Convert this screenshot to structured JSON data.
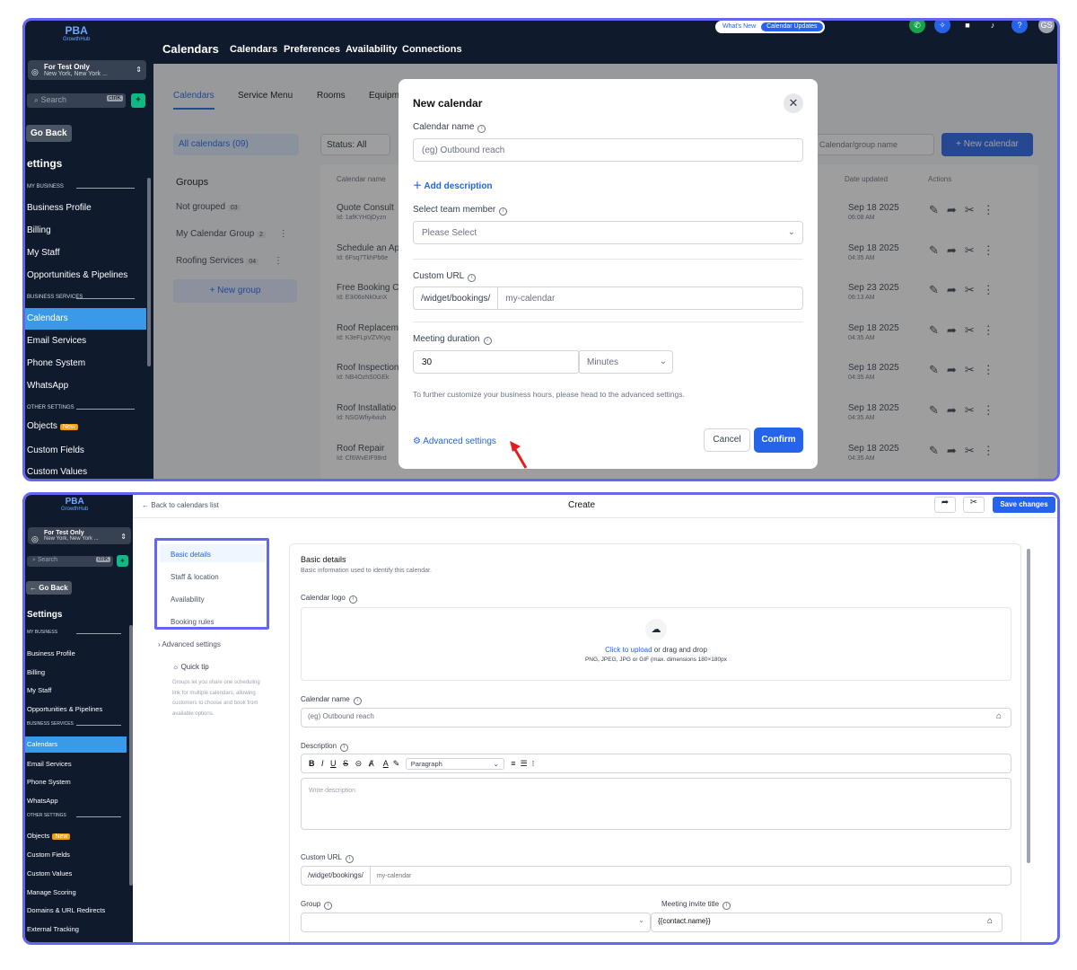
{
  "brand": {
    "name": "PBA",
    "sub": "GrowthHub"
  },
  "account": {
    "name": "For Test Only",
    "location": "New York, New York ..."
  },
  "search": {
    "placeholder": "Search",
    "shortcut": "ctrlK"
  },
  "sidebar": {
    "go_back": "Go Back",
    "go_back_bottom": "← Go Back",
    "title": "ettings",
    "title_bottom": "Settings",
    "sec_my_business": "MY BUSINESS",
    "sec_business_services": "BUSINESS SERVICES",
    "sec_other_settings": "OTHER SETTINGS",
    "new_badge": "New",
    "top_items": [
      "Business Profile",
      "Billing",
      "My Staff",
      "Opportunities & Pipelines",
      "Calendars",
      "Email Services",
      "Phone System",
      "WhatsApp",
      "Objects",
      "Custom Fields",
      "Custom Values"
    ],
    "bottom_items": [
      "Business Profile",
      "Billing",
      "My Staff",
      "Opportunities & Pipelines",
      "Calendars",
      "Email Services",
      "Phone System",
      "WhatsApp",
      "Objects",
      "Custom Fields",
      "Custom Values",
      "Manage Scoring",
      "Domains & URL Redirects",
      "External Tracking"
    ]
  },
  "header": {
    "title": "Calendars",
    "tabs": [
      "Calendars",
      "Preferences",
      "Availability",
      "Connections"
    ],
    "whats_new": "What's New",
    "calendar_updates": "Calendar Updates",
    "avatar": "GS"
  },
  "subtabs": [
    "Calendars",
    "Service Menu",
    "Rooms",
    "Equipm"
  ],
  "filters": {
    "all": "All calendars (09)",
    "status": "Status: All",
    "search_placeholder": "Calendar/group name",
    "new_calendar": "+ New calendar"
  },
  "groups": {
    "title": "Groups",
    "items": [
      {
        "name": "Not grouped",
        "count": "03"
      },
      {
        "name": "My Calendar Group",
        "count": "2"
      },
      {
        "name": "Roofing Services",
        "count": "04"
      }
    ],
    "new_group": "+ New group"
  },
  "table": {
    "col_name": "Calendar name",
    "col_date": "Date updated",
    "col_actions": "Actions",
    "rows": [
      {
        "name": "Quote Consult",
        "id": "Id: 1afKYH0jDyzn",
        "date": "Sep 18 2025",
        "time": "06:08 AM"
      },
      {
        "name": "Schedule an Ap",
        "id": "Id: 6Fsq7TkhPb6e",
        "date": "Sep 18 2025",
        "time": "04:35 AM"
      },
      {
        "name": "Free Booking C",
        "id": "Id: E3i06oNk0unX",
        "date": "Sep 23 2025",
        "time": "06:13 AM"
      },
      {
        "name": "Roof Replacem",
        "id": "Id: K3eFLpVZVKyq",
        "date": "Sep 18 2025",
        "time": "04:35 AM"
      },
      {
        "name": "Roof Inspection",
        "id": "Id: NB4OzhS0GEk",
        "date": "Sep 18 2025",
        "time": "04:35 AM"
      },
      {
        "name": "Roof Installatio",
        "id": "Id: NSGWfiy4viuh",
        "date": "Sep 18 2025",
        "time": "04:35 AM"
      },
      {
        "name": "Roof Repair",
        "id": "Id: Cf6WvEIF98rd",
        "date": "Sep 18 2025",
        "time": "04:35 AM"
      }
    ]
  },
  "modal": {
    "title": "New calendar",
    "name_label": "Calendar name",
    "name_placeholder": "(eg) Outbound reach",
    "add_description": "Add description",
    "team_label": "Select team member",
    "team_placeholder": "Please Select",
    "url_label": "Custom URL",
    "url_prefix": "/widget/bookings/",
    "url_value": "my-calendar",
    "duration_label": "Meeting duration",
    "duration_value": "30",
    "duration_unit": "Minutes",
    "hint": "To further customize your business hours, please head to the advanced settings.",
    "advanced": "Advanced settings",
    "cancel": "Cancel",
    "confirm": "Confirm"
  },
  "create": {
    "back": "Back to calendars list",
    "title": "Create",
    "save": "Save changes",
    "nav": [
      "Basic details",
      "Staff & location",
      "Availability",
      "Booking rules"
    ],
    "advanced": "Advanced settings",
    "tip_title": "Quick tip",
    "tip_text": "Groups let you share one scheduling link for multiple calendars, allowing customers to choose and book from available options.",
    "section_title": "Basic details",
    "section_sub": "Basic information used to identify this calendar.",
    "logo_label": "Calendar logo",
    "upload_link": "Click to upload",
    "upload_rest": " or drag and drop",
    "upload_hint": "PNG, JPEG, JPG or GIF (max. dimensions 180×180px",
    "name_label": "Calendar name",
    "name_placeholder": "(eg) Outbound reach",
    "desc_label": "Description",
    "paragraph": "Paragraph",
    "desc_placeholder": "Write description",
    "url_label": "Custom URL",
    "url_prefix": "/widget/bookings/",
    "url_value": "my-calendar",
    "group_label": "Group",
    "invite_label": "Meeting invite title",
    "invite_value": "{{contact.name}}"
  },
  "colors": {
    "sidebar": "#0f1b2d",
    "accent": "#2563eb",
    "highlight": "#6366f1",
    "active": "#3b9ae8"
  }
}
